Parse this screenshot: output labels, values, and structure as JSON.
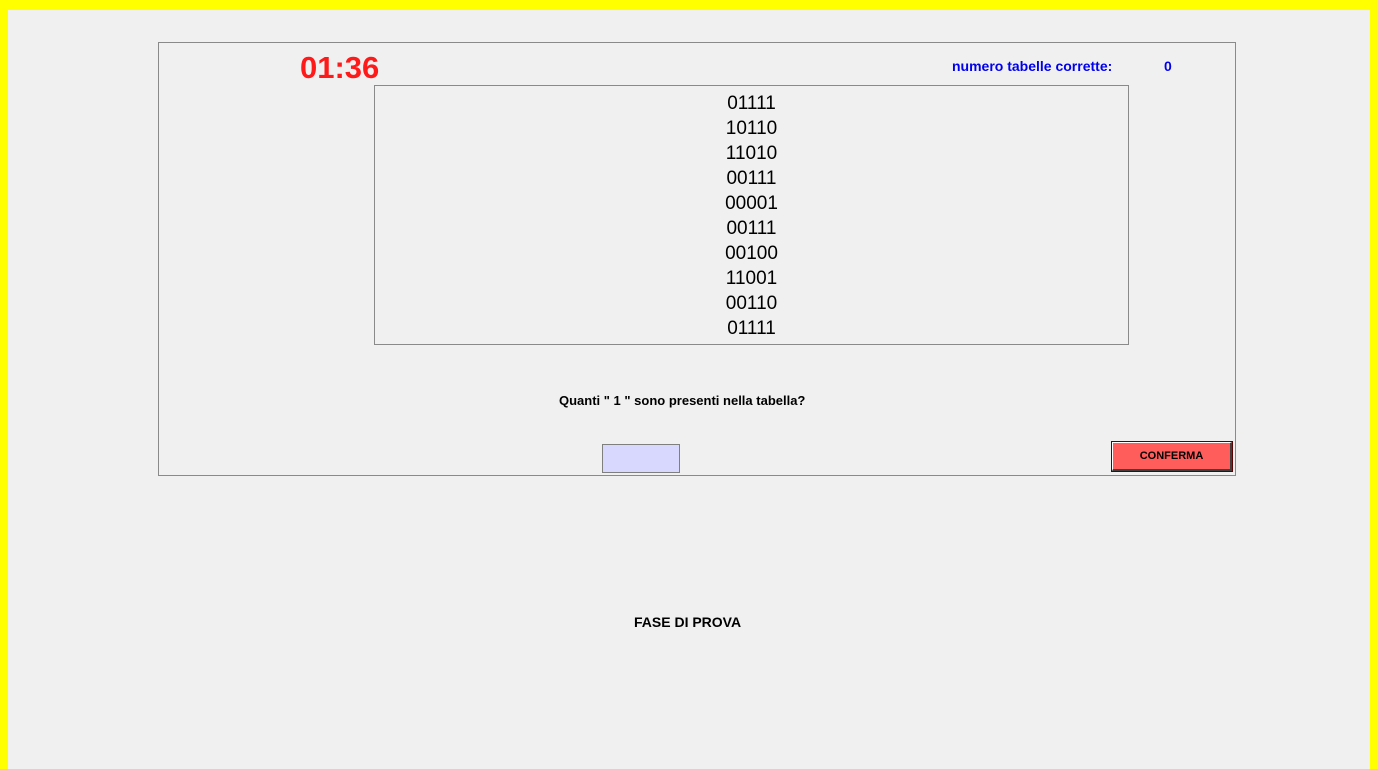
{
  "timer": {
    "value": "01:36",
    "color": "#ff1a1a"
  },
  "score": {
    "label": "numero tabelle corrette:",
    "value": "0",
    "color": "#0000ee"
  },
  "table": {
    "rows": [
      "01111",
      "10110",
      "11010",
      "00111",
      "00001",
      "00111",
      "00100",
      "11001",
      "00110",
      "01111"
    ]
  },
  "question": {
    "text": "Quanti \" 1 \" sono presenti nella tabella?"
  },
  "answer": {
    "value": "",
    "placeholder": "",
    "background": "#d8d8ff"
  },
  "confirm": {
    "label": "CONFERMA",
    "color": "#ff5c5c"
  },
  "phase": {
    "label": "FASE DI PROVA"
  },
  "frame": {
    "border_color": "#ffff00"
  }
}
